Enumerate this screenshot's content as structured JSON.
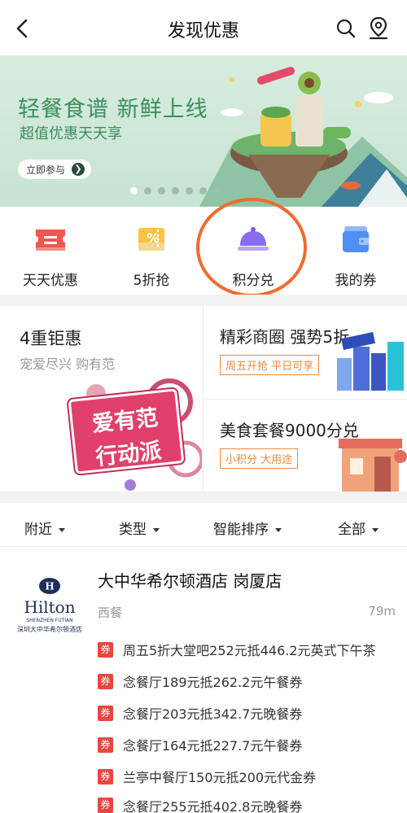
{
  "header": {
    "title": "发现优惠"
  },
  "banner": {
    "headline": "轻餐食谱 新鲜上线",
    "subline": "超值优惠天天享",
    "join_label": "立即参与",
    "slides": 7,
    "active_slide": 0
  },
  "quick_nav": [
    {
      "label": "天天优惠",
      "icon": "ticket-icon"
    },
    {
      "label": "5折抢",
      "icon": "percent-coupon-icon"
    },
    {
      "label": "积分兑",
      "icon": "cloche-icon"
    },
    {
      "label": "我的券",
      "icon": "wallet-icon"
    }
  ],
  "promos": {
    "left": {
      "title": "4重钜惠",
      "subtitle": "宠爱尽兴 购有范",
      "art_text_1": "爱有范",
      "art_text_2": "行动派"
    },
    "right_top": {
      "title": "精彩商圈 强势5折",
      "tag": "周五开抢 平日可享"
    },
    "right_bottom": {
      "title": "美食套餐9000分兑",
      "tag": "小积分 大用途"
    }
  },
  "filters": [
    "附近",
    "类型",
    "智能排序",
    "全部"
  ],
  "store": {
    "logo_brand": "Hilton",
    "logo_sub": "SHENZHEN FUTIAN",
    "logo_cn": "深圳大中华希尔顿酒店",
    "name": "大中华希尔顿酒店 岗厦店",
    "category": "西餐",
    "distance": "79m",
    "badge": "券",
    "deals": [
      "周五5折大堂吧252元抵446.2元英式下午茶",
      "念餐厅189元抵262.2元午餐券",
      "念餐厅203元抵342.7元晚餐券",
      "念餐厅164元抵227.7元午餐券",
      "兰亭中餐厅150元抵200元代金券",
      "念餐厅255元抵402.8元晚餐券"
    ]
  },
  "colors": {
    "accent": "#f26a2f",
    "badge": "#e8473f",
    "tag": "#f08a3c"
  }
}
